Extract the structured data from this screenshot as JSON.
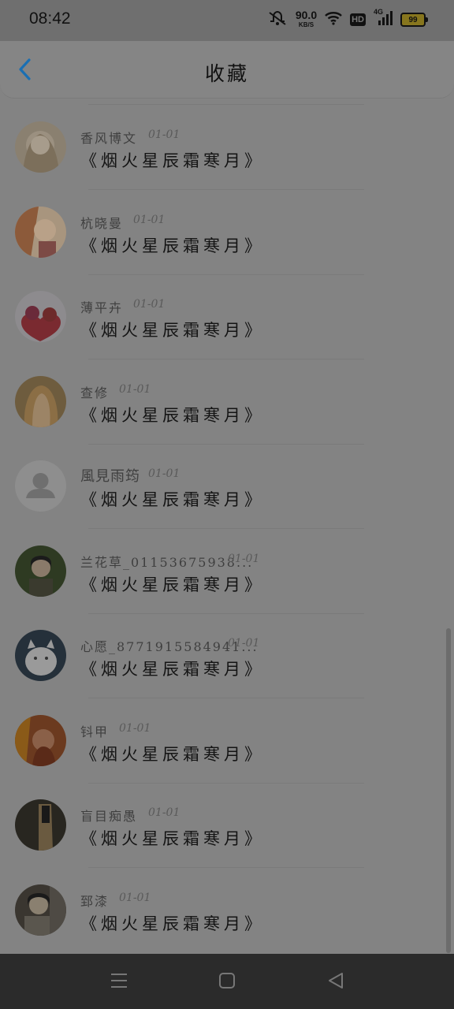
{
  "status_bar": {
    "time": "08:42",
    "net_speed_value": "90.0",
    "net_speed_unit": "KB/S",
    "hd": "HD",
    "network": "4G",
    "battery": "99"
  },
  "header": {
    "title": "收藏",
    "back_icon": "chevron-left-icon",
    "accent_color": "#1a6fb3"
  },
  "favorites": [
    {
      "author": "香风博文",
      "date": "01-01",
      "title": "《烟火星辰霜寒月》"
    },
    {
      "author": "杭晓曼",
      "date": "01-01",
      "title": "《烟火星辰霜寒月》"
    },
    {
      "author": "薄平卉",
      "date": "01-01",
      "title": "《烟火星辰霜寒月》"
    },
    {
      "author": "查修",
      "date": "01-01",
      "title": "《烟火星辰霜寒月》"
    },
    {
      "author": "風見雨筠",
      "date": "01-01",
      "title": "《烟火星辰霜寒月》"
    },
    {
      "author": "兰花草_01153675938...",
      "date": "01-01",
      "title": "《烟火星辰霜寒月》"
    },
    {
      "author": "心愿_8771915584941...",
      "date": "01-01",
      "title": "《烟火星辰霜寒月》"
    },
    {
      "author": "钭甲",
      "date": "01-01",
      "title": "《烟火星辰霜寒月》"
    },
    {
      "author": "盲目痴愚",
      "date": "01-01",
      "title": "《烟火星辰霜寒月》"
    },
    {
      "author": "郅漆",
      "date": "01-01",
      "title": "《烟火星辰霜寒月》"
    }
  ],
  "nav_bar": {
    "menu_icon": "menu-icon",
    "home_icon": "home-square-icon",
    "back_icon": "back-triangle-icon"
  }
}
